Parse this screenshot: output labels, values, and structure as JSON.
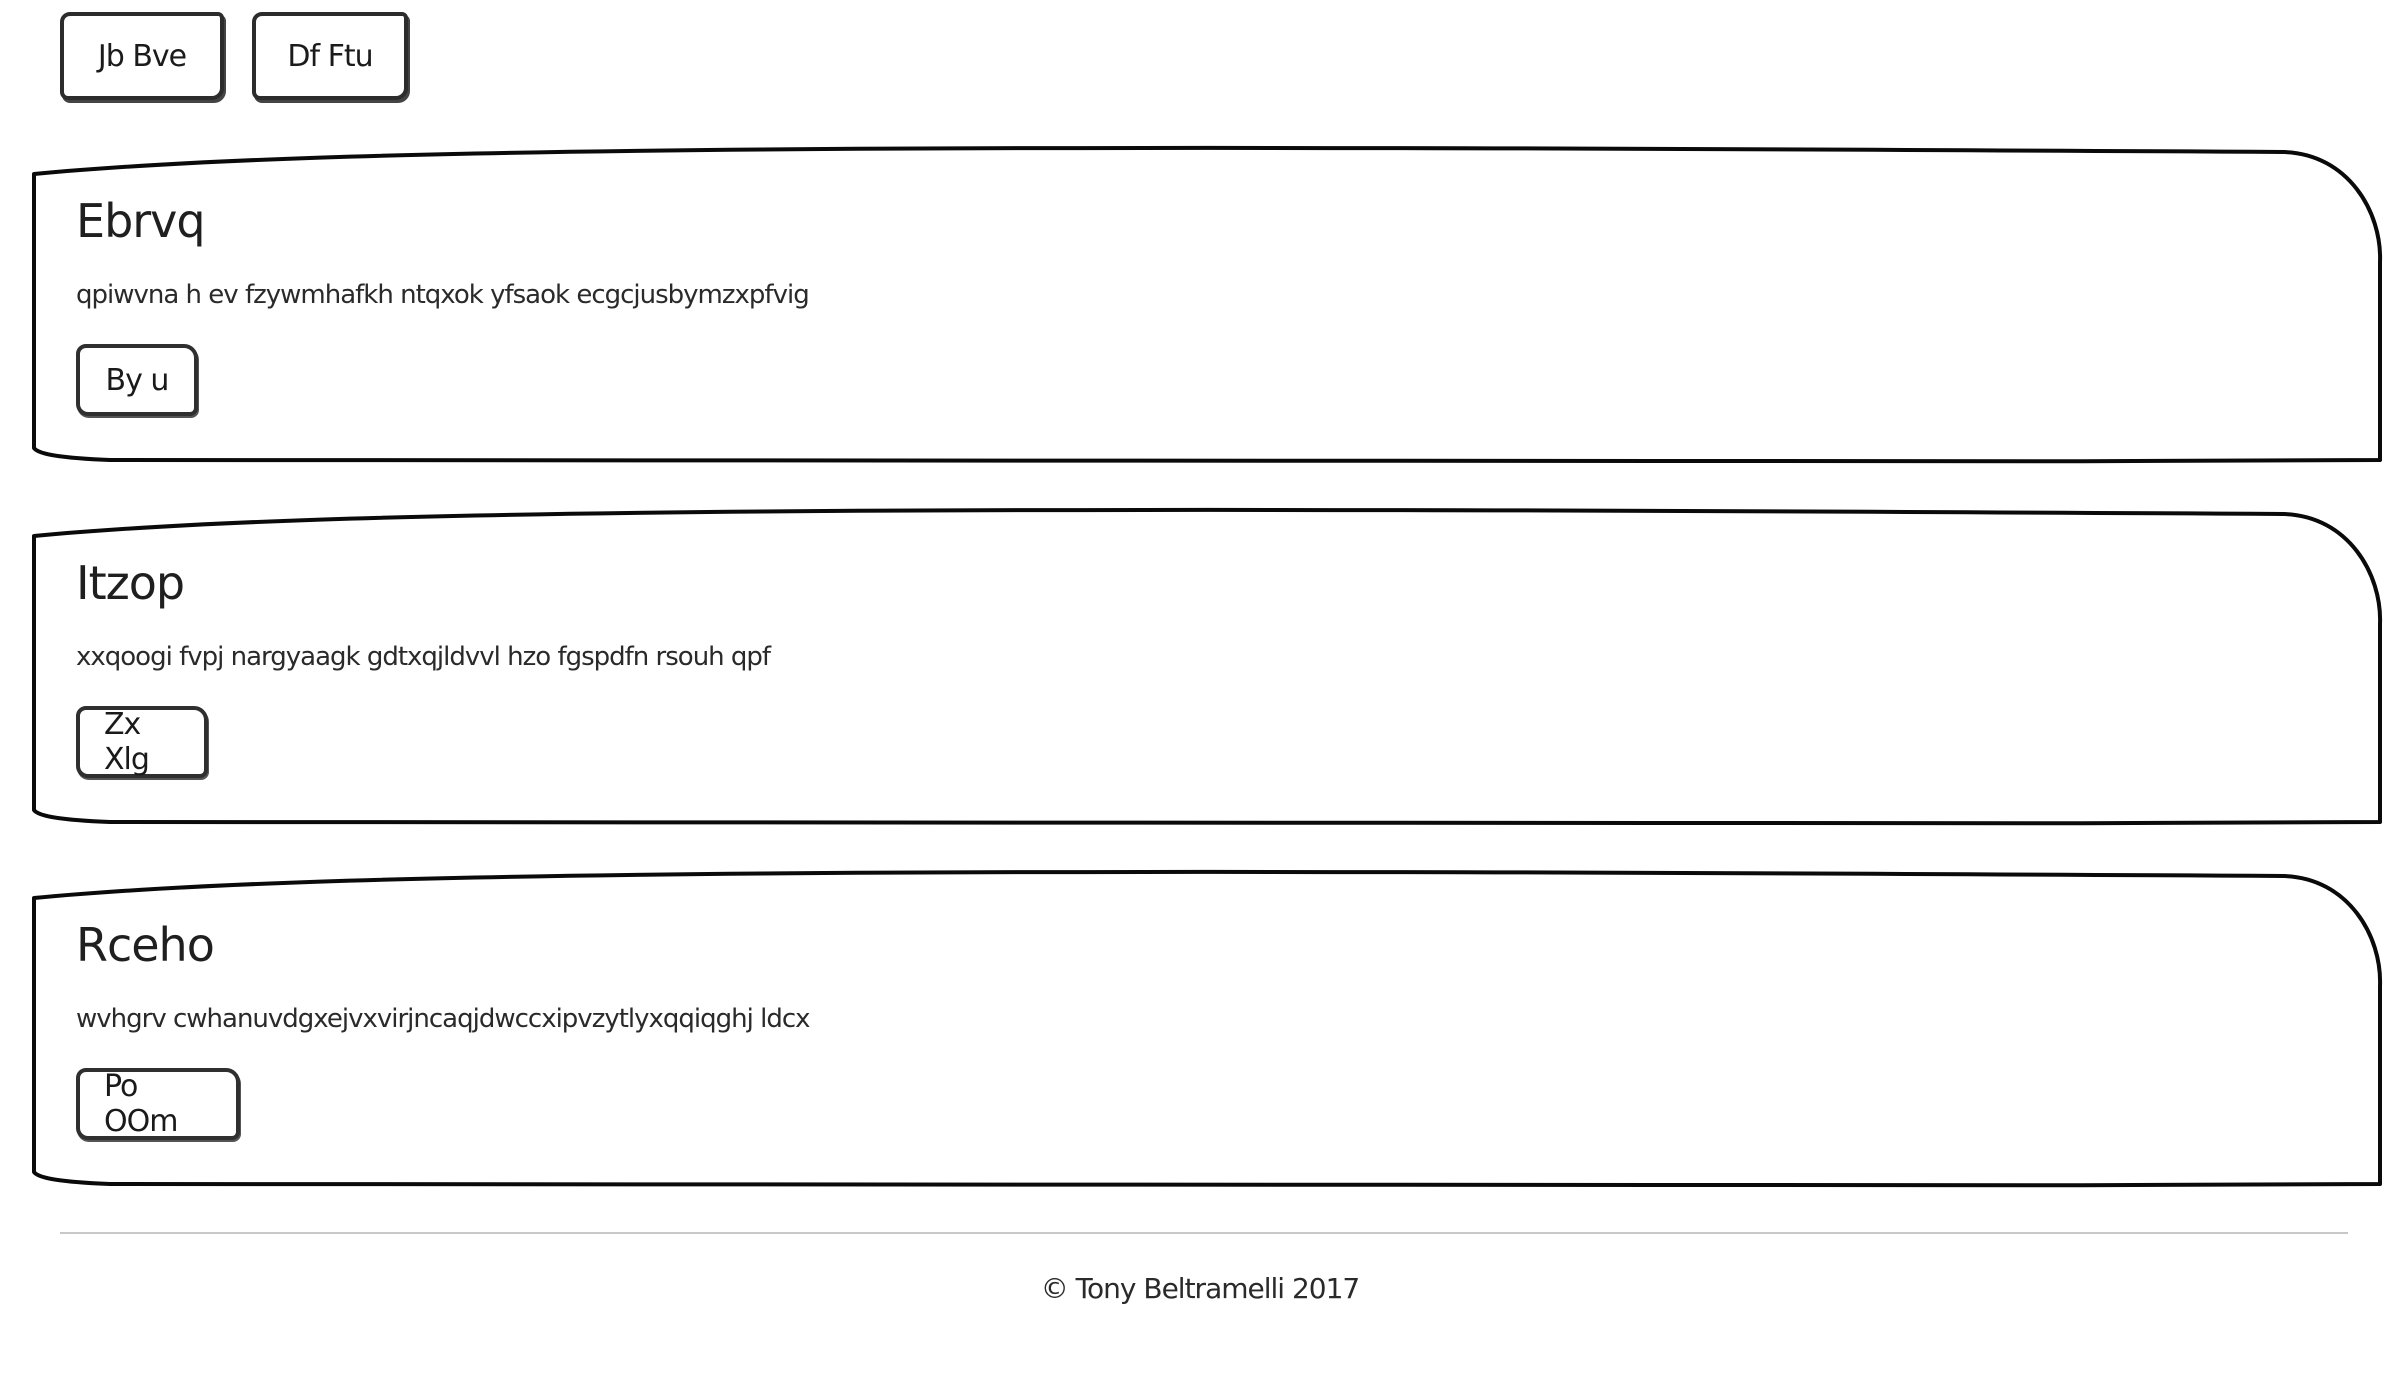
{
  "nav": {
    "buttons": [
      {
        "label": "Jb Bve"
      },
      {
        "label": "Df Ftu"
      }
    ]
  },
  "cards": [
    {
      "title": "Ebrvq",
      "text": "qpiwvna h ev fzywmhafkh ntqxok yfsaok ecgcjusbymzxpfvig",
      "button": "By u"
    },
    {
      "title": "Itzop",
      "text": "xxqoogi fvpj nargyaagk gdtxqjldvvl hzo fgspdfn rsouh qpf",
      "button": "Zx Xlg"
    },
    {
      "title": "Rceho",
      "text": "wvhgrv cwhanuvdgxejvxvirjncaqjdwccxipvzytlyxqqiqghj ldcx",
      "button": "Po OOm"
    }
  ],
  "footer": {
    "text": "© Tony Beltramelli 2017"
  }
}
